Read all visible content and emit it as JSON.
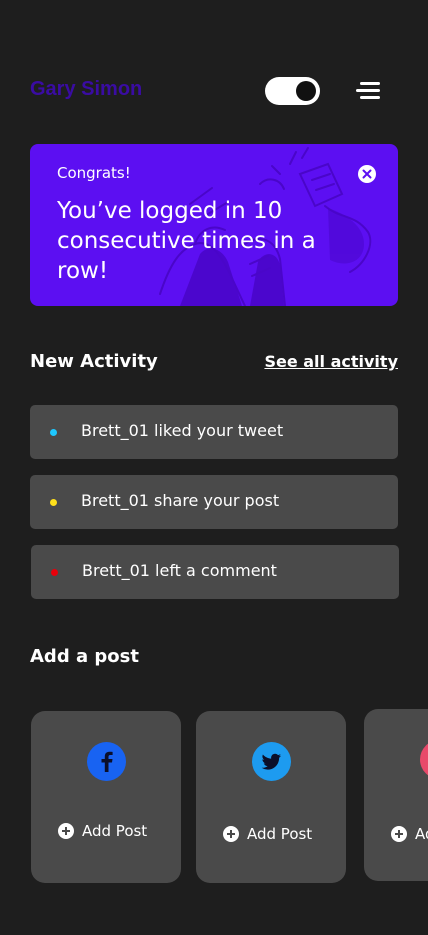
{
  "header": {
    "user_name": "Gary Simon",
    "toggle_state": "on"
  },
  "banner": {
    "label": "Congrats!",
    "message": "You’ve logged in 10 consecutive times in a row!",
    "background": "#5c0ff2"
  },
  "activity": {
    "title": "New Activity",
    "see_all_label": "See all activity",
    "items": [
      {
        "text": "Brett_01 liked your tweet",
        "dot_color": "#1ec8ff"
      },
      {
        "text": "Brett_01 share your post",
        "dot_color": "#ffe01b"
      },
      {
        "text": "Brett_01 left a comment",
        "dot_color": "#e8000b"
      }
    ]
  },
  "posts": {
    "title": "Add a post",
    "cards": [
      {
        "network_icon": "facebook-icon",
        "icon_color": "#1863f2",
        "label": "Add Post"
      },
      {
        "network_icon": "twitter-icon",
        "icon_color": "#1d9bf0",
        "label": "Add Post"
      },
      {
        "network_icon": "instagram-icon",
        "icon_color": "#e8496a",
        "label": "Add Post"
      }
    ]
  }
}
